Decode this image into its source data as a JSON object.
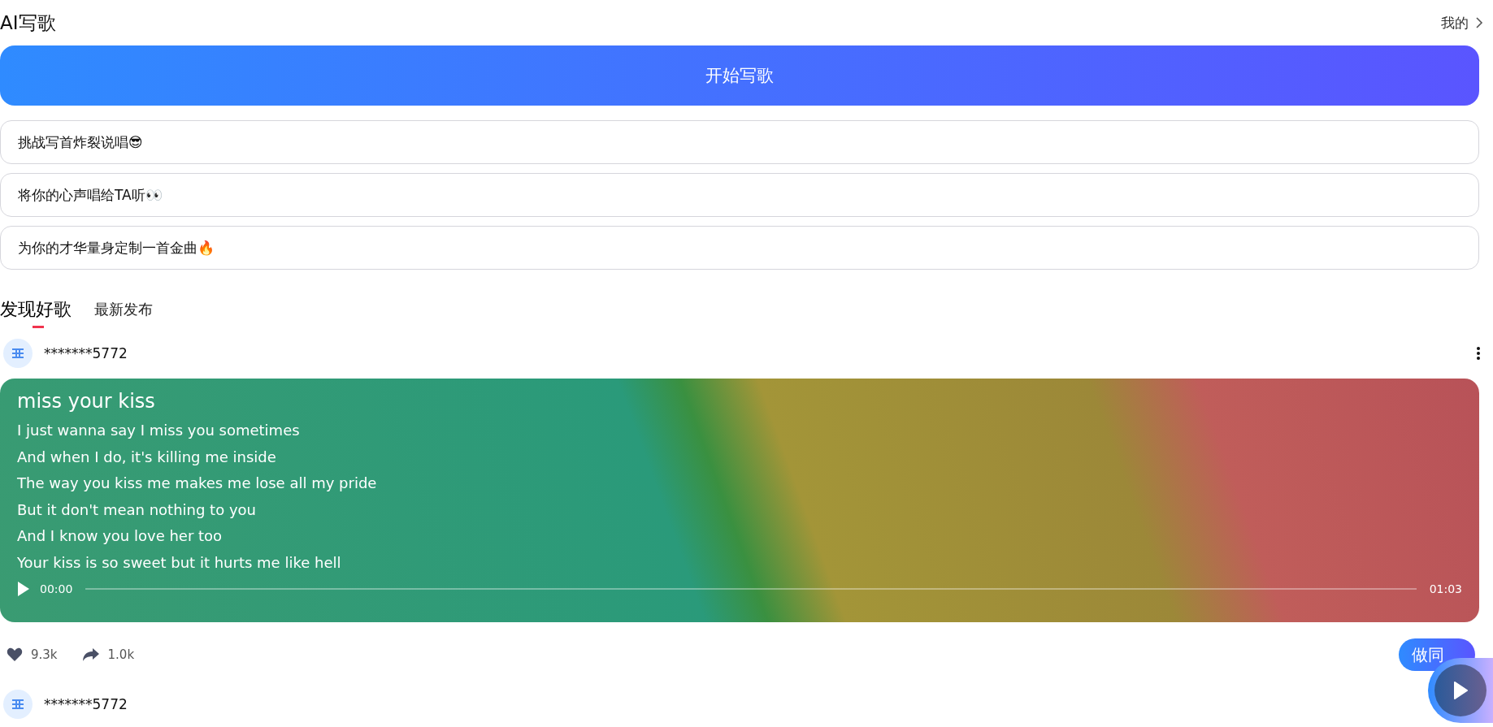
{
  "header": {
    "title": "AI写歌",
    "mine_link": "我的"
  },
  "start_button": "开始写歌",
  "prompts": [
    "挑战写首炸裂说唱😎",
    "将你的心声唱给TA听👀",
    "为你的才华量身定制一首金曲🔥"
  ],
  "tabs": [
    {
      "label": "发现好歌",
      "selected": true
    },
    {
      "label": "最新发布",
      "selected": false
    }
  ],
  "posts": [
    {
      "user": "*******5772",
      "song": {
        "title": "miss your kiss",
        "lyrics": [
          "I just wanna say I miss you sometimes",
          "And when I do, it's killing me inside",
          "The way you kiss me makes me lose all my pride",
          "But it don't mean nothing to you",
          "And I know you love her too",
          "Your kiss is so sweet but it hurts me like hell"
        ],
        "current_time": "00:00",
        "duration": "01:03",
        "level": 0
      },
      "likes": "9.3k",
      "shares": "1.0k",
      "action": "做同"
    },
    {
      "user": "*******5772"
    }
  ]
}
